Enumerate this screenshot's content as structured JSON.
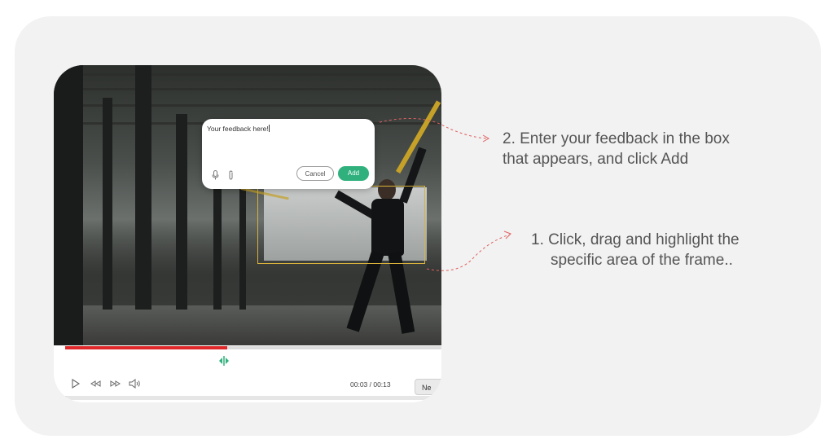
{
  "feedback_popup": {
    "input_text": "Your feedback here!",
    "cancel_label": "Cancel",
    "add_label": "Add"
  },
  "player": {
    "progress": 0.43,
    "time_display": "00:03 / 00:13",
    "next_label": "Ne"
  },
  "instructions": {
    "step2_line1": "2. Enter your feedback in the box",
    "step2_line2": "that appears, and click Add",
    "step1_line1": "1.  Click, drag and highlight the",
    "step1_line2": "specific area of the frame.."
  },
  "colors": {
    "accent_green": "#2fb07c",
    "progress_red": "#e0282b",
    "highlight_yellow": "#d8b23a",
    "connector_red": "#e06060"
  },
  "icons": [
    "mic-icon",
    "paperclip-icon",
    "comment-marker-icon",
    "play-icon",
    "rewind-icon",
    "fast-forward-icon",
    "volume-icon"
  ]
}
